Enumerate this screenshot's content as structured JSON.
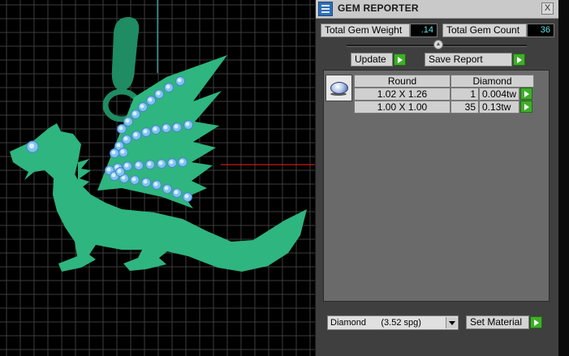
{
  "viewport": {
    "colors": {
      "background": "#000000",
      "grid": "#3d3d3d",
      "model": "#2fb57f",
      "bail": "#1f8c63",
      "gem": "#7fc4f2",
      "axis_red": "#c51b1b",
      "axis_cyan": "#3fa6a6"
    }
  },
  "panel": {
    "title": "GEM REPORTER",
    "close_label": "X",
    "total_weight_label": "Total Gem Weight",
    "total_weight_value": ".14",
    "total_count_label": "Total Gem Count",
    "total_count_value": "36",
    "update_label": "Update",
    "save_report_label": "Save Report",
    "gem_group": {
      "cut": "Round",
      "material": "Diamond",
      "rows": [
        {
          "size": "1.02 X 1.26",
          "count": "1",
          "weight": "0.004tw"
        },
        {
          "size": "1.00 X 1.00",
          "count": "35",
          "weight": "0.13tw"
        }
      ]
    },
    "material_select_value": "Diamond      (3.52 spg)",
    "set_material_label": "Set Material"
  }
}
